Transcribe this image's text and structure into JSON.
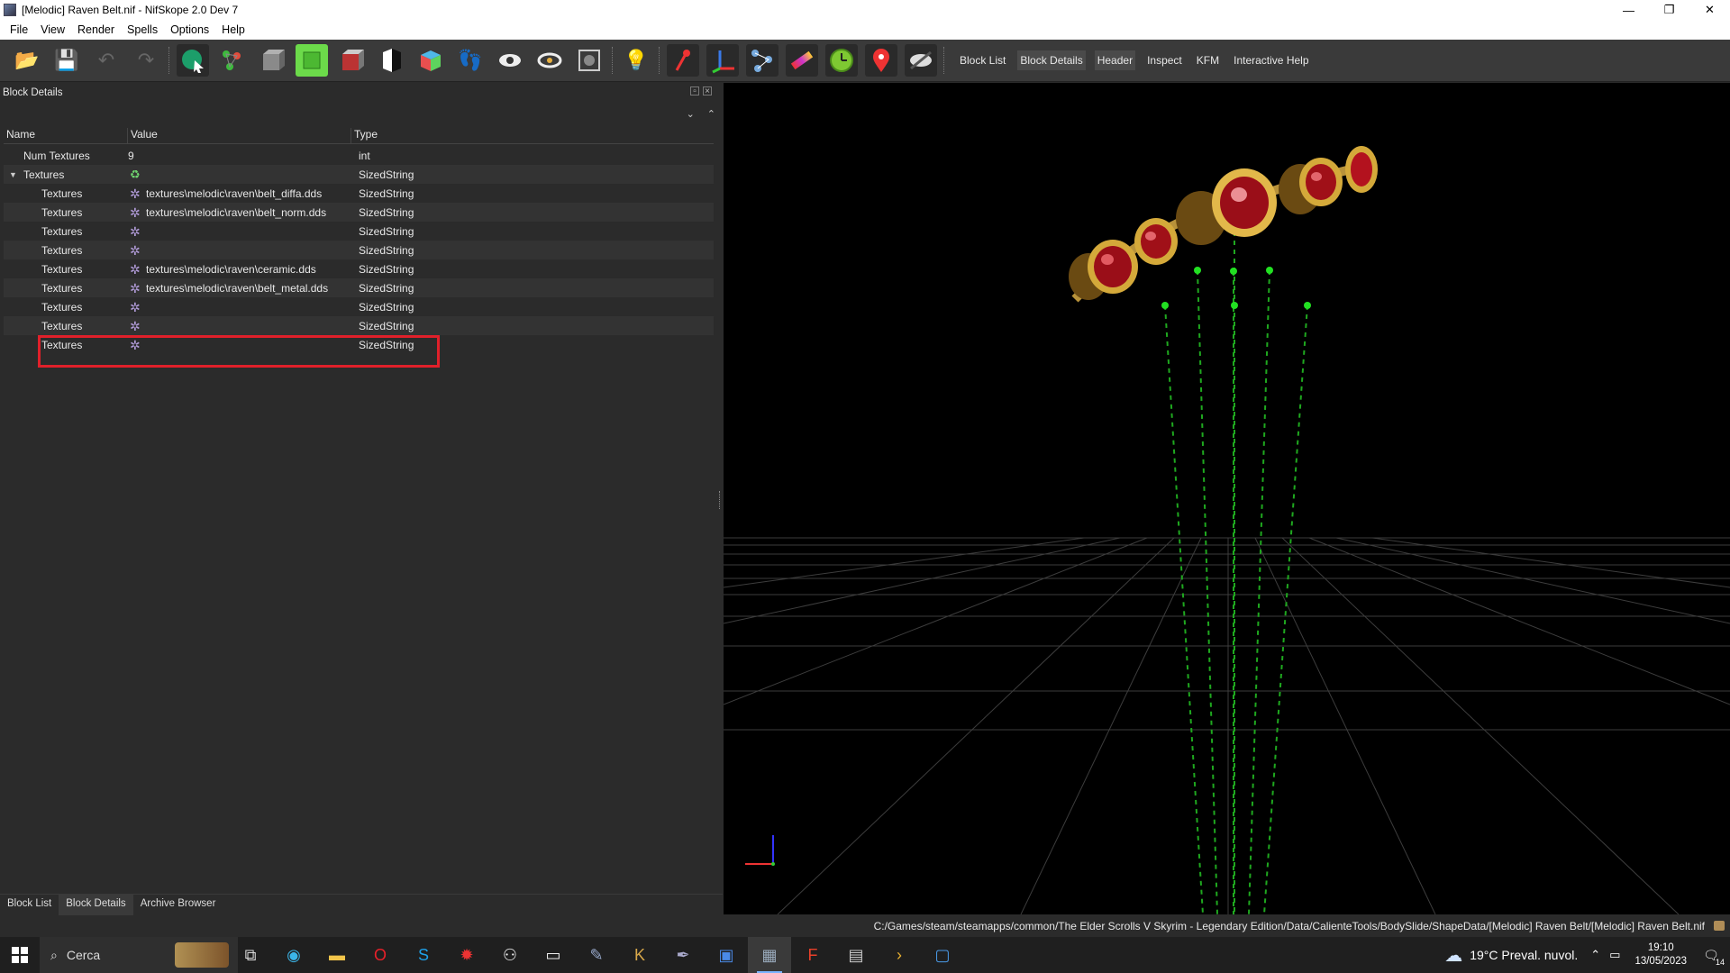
{
  "window": {
    "title": "[Melodic] Raven Belt.nif - NifSkope 2.0 Dev 7",
    "minimize": "—",
    "restore": "❐",
    "close": "✕"
  },
  "menu": [
    "File",
    "View",
    "Render",
    "Spells",
    "Options",
    "Help"
  ],
  "toolbar": {
    "text_buttons": [
      "Block List",
      "Block Details",
      "Header",
      "Inspect",
      "KFM",
      "Interactive Help"
    ],
    "active_text_button": "Block Details"
  },
  "panel": {
    "title": "Block Details",
    "columns": [
      "Name",
      "Value",
      "Type"
    ],
    "rows": [
      {
        "name": "Num Textures",
        "value": "9",
        "type": "int",
        "icon": "none"
      },
      {
        "name": "Textures",
        "value": "",
        "type": "SizedString",
        "icon": "recycle-icon"
      },
      {
        "name": "Textures",
        "value": "textures\\melodic\\raven\\belt_diffa.dds",
        "type": "SizedString",
        "icon": "gear-icon"
      },
      {
        "name": "Textures",
        "value": "textures\\melodic\\raven\\belt_norm.dds",
        "type": "SizedString",
        "icon": "gear-icon"
      },
      {
        "name": "Textures",
        "value": "",
        "type": "SizedString",
        "icon": "gear-icon"
      },
      {
        "name": "Textures",
        "value": "",
        "type": "SizedString",
        "icon": "gear-icon"
      },
      {
        "name": "Textures",
        "value": "textures\\melodic\\raven\\ceramic.dds",
        "type": "SizedString",
        "icon": "gear-icon"
      },
      {
        "name": "Textures",
        "value": "textures\\melodic\\raven\\belt_metal.dds",
        "type": "SizedString",
        "icon": "gear-icon"
      },
      {
        "name": "Textures",
        "value": "",
        "type": "SizedString",
        "icon": "gear-icon"
      },
      {
        "name": "Textures",
        "value": "",
        "type": "SizedString",
        "icon": "gear-icon"
      },
      {
        "name": "Textures",
        "value": "",
        "type": "SizedString",
        "icon": "gear-icon"
      }
    ],
    "highlight_color": "#e0202a"
  },
  "bottom_tabs": [
    "Block List",
    "Block Details",
    "Archive Browser"
  ],
  "active_bottom_tab": "Block Details",
  "status": {
    "path": "C:/Games/steam/steamapps/common/The Elder Scrolls V Skyrim - Legendary Edition/Data/CalienteTools/BodySlide/ShapeData/[Melodic] Raven Belt/[Melodic] Raven Belt.nif"
  },
  "taskbar": {
    "search_placeholder": "Cerca",
    "weather": "19°C  Preval. nuvol.",
    "time": "19:10",
    "date": "13/05/2023",
    "notifications": "14"
  },
  "colors": {
    "viewport_bg": "#000000",
    "skeleton_green": "#2bd92b",
    "gem_red": "#b3121e",
    "gold": "#d4a93a"
  }
}
